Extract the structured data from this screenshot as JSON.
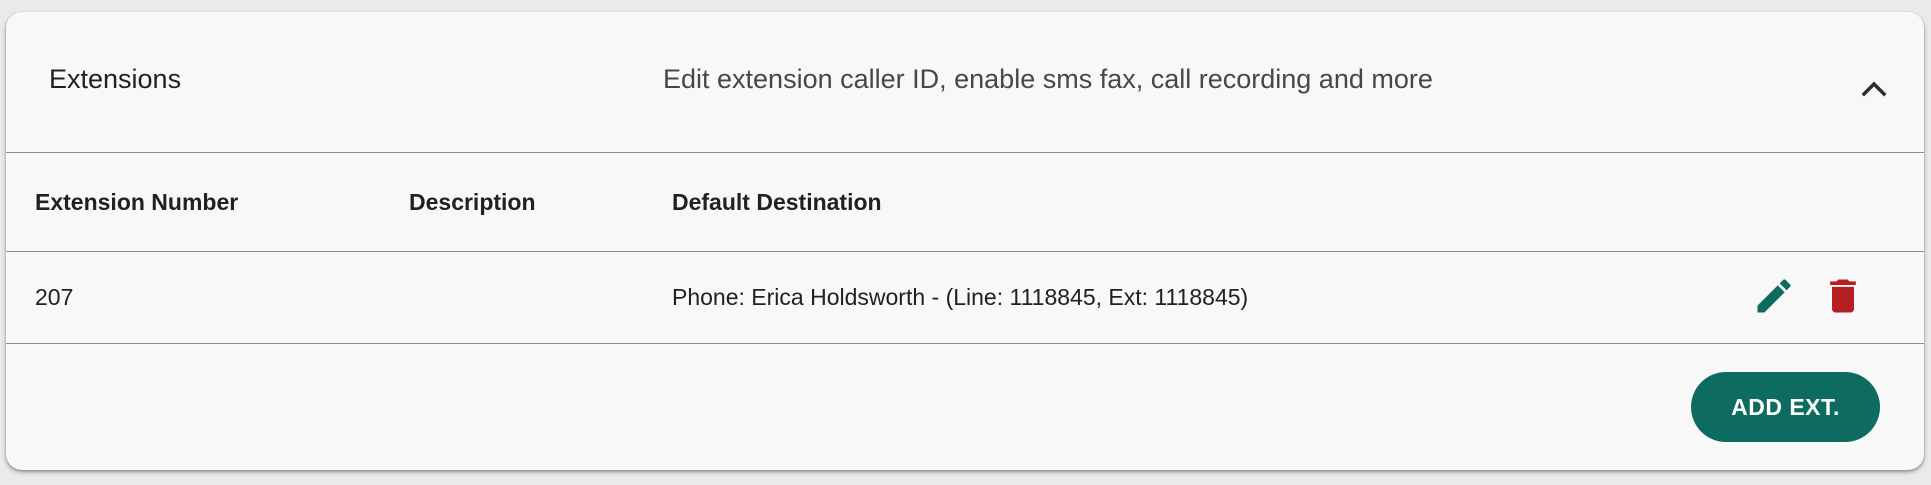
{
  "panel": {
    "title": "Extensions",
    "subtitle": "Edit extension caller ID, enable sms fax, call recording and more",
    "collapse_icon": "chevron-up-icon"
  },
  "table": {
    "columns": [
      "Extension Number",
      "Description",
      "Default Destination"
    ],
    "rows": [
      {
        "extension_number": "207",
        "description": "",
        "default_destination": "Phone: Erica Holdsworth - (Line: 1118845, Ext: 1118845)",
        "actions": [
          "edit-icon",
          "delete-icon"
        ]
      }
    ]
  },
  "footer": {
    "add_button_label": "ADD EXT."
  },
  "colors": {
    "primary": "#0d6b5f",
    "danger": "#b51f22",
    "surface": "#f7f8f7",
    "background": "#eaebe8"
  }
}
